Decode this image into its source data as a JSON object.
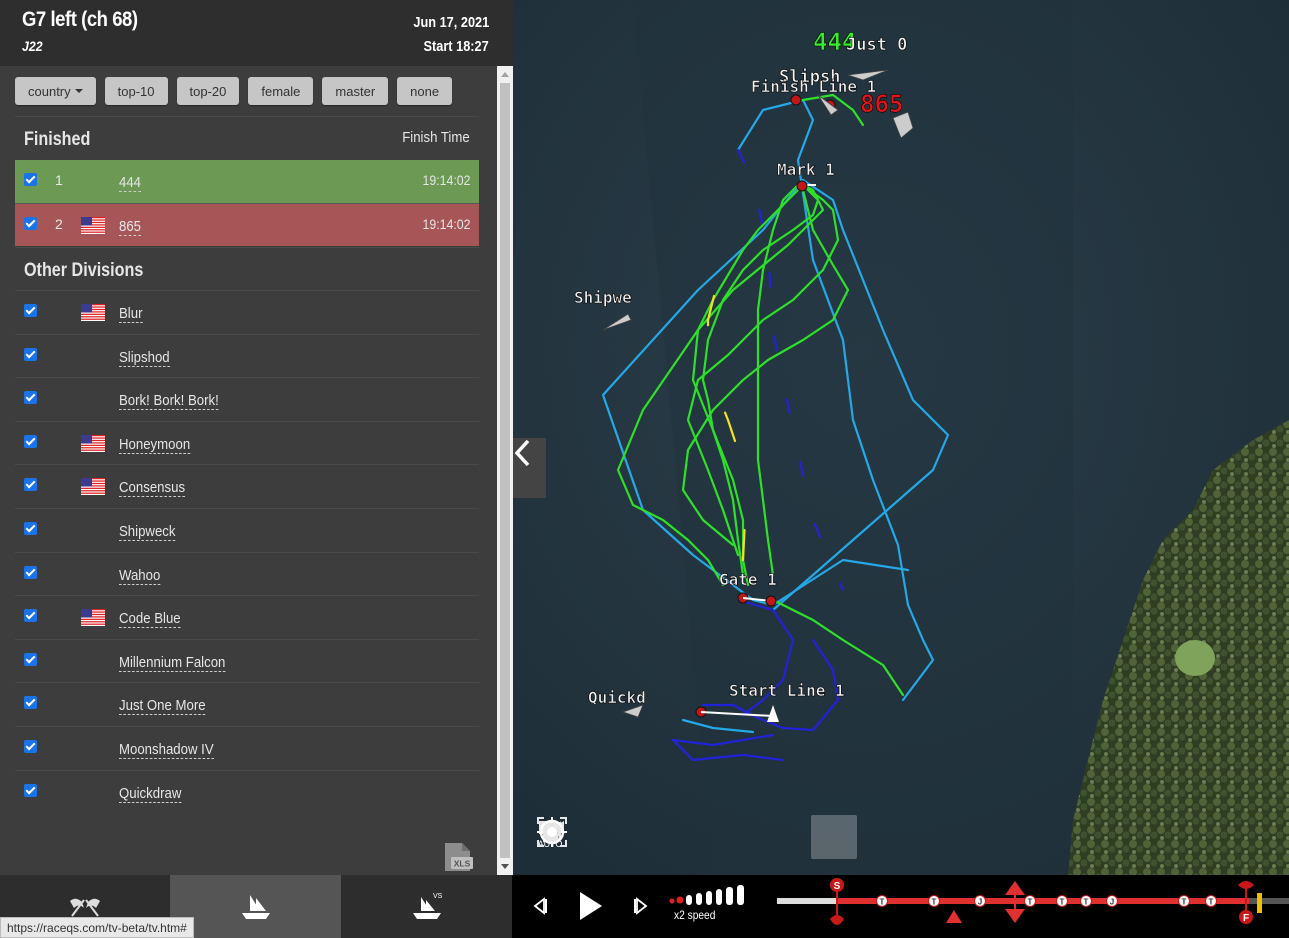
{
  "header": {
    "title": "G7 left (ch 68)",
    "class": "J22",
    "date": "Jun 17, 2021",
    "start": "Start 18:27"
  },
  "filters": [
    "country",
    "top-10",
    "top-20",
    "female",
    "master",
    "none"
  ],
  "finished": {
    "label": "Finished",
    "time_header": "Finish Time",
    "rows": [
      {
        "place": "1",
        "name": "444",
        "time": "19:14:02",
        "flag": "",
        "color": "#6c9a55"
      },
      {
        "place": "2",
        "name": "865",
        "time": "19:14:02",
        "flag": "us",
        "color": "#a75658"
      }
    ]
  },
  "other": {
    "label": "Other Divisions",
    "rows": [
      {
        "name": "Blur",
        "flag": "us"
      },
      {
        "name": "Slipshod",
        "flag": ""
      },
      {
        "name": "Bork! Bork! Bork!",
        "flag": ""
      },
      {
        "name": "Honeymoon",
        "flag": "us"
      },
      {
        "name": "Consensus",
        "flag": "us"
      },
      {
        "name": "Shipweck",
        "flag": ""
      },
      {
        "name": "Wahoo",
        "flag": ""
      },
      {
        "name": "Code Blue",
        "flag": "us"
      },
      {
        "name": "Millennium Falcon",
        "flag": ""
      },
      {
        "name": "Just One More",
        "flag": ""
      },
      {
        "name": "Moonshadow IV",
        "flag": ""
      },
      {
        "name": "Quickdraw",
        "flag": ""
      }
    ]
  },
  "map": {
    "labels": {
      "boat_444": "444",
      "boat_865": "865",
      "just": "Just 0",
      "slipsh": "Slipsh",
      "finish_line": "Finish Line 1",
      "mark1": "Mark 1",
      "shipwe": "Shipwe",
      "gate1": "Gate 1",
      "start_line": "Start Line 1",
      "quickd": "Quickd"
    },
    "tools": [
      {
        "name": "auto-camera-icon",
        "label": "AUTO"
      },
      {
        "name": "fit-map-icon",
        "label": ""
      },
      {
        "name": "fit-fleet-icon",
        "label": ""
      },
      {
        "name": "tracks-icon",
        "label": ""
      },
      {
        "name": "sail-icon",
        "label": ""
      },
      {
        "name": "helm-icon",
        "label": ""
      },
      {
        "name": "target-icon",
        "label": ""
      }
    ],
    "colors": {
      "water": "#22343f",
      "land": "#3c4a2a",
      "track_green": "#2ee02a",
      "track_cyan": "#25a8e6",
      "track_blue": "#2222d8",
      "track_yellow": "#f5e21b"
    }
  },
  "playback": {
    "speed": "x2 speed",
    "timeline_markers": [
      "S",
      "T",
      "T",
      "J",
      "T",
      "T",
      "T",
      "J",
      "T",
      "T",
      "F"
    ]
  },
  "status_url": "https://raceqs.com/tv-beta/tv.htm#"
}
